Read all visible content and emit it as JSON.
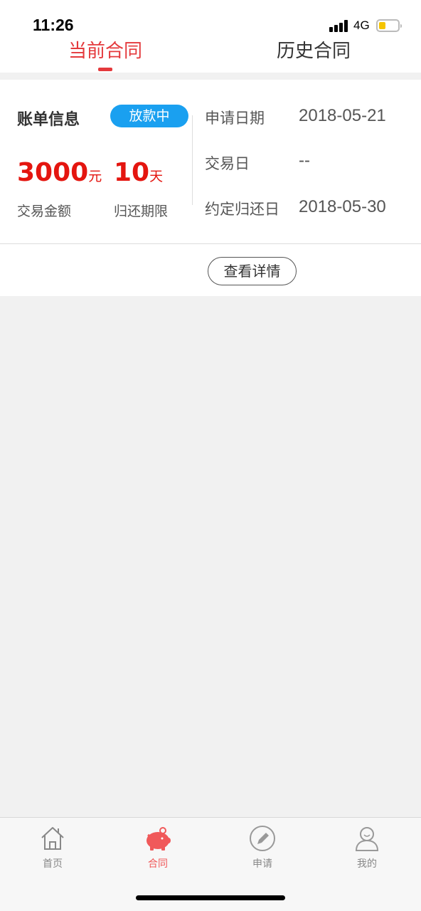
{
  "status_bar": {
    "time": "11:26",
    "network": "4G",
    "battery_level": 0.3,
    "battery_color": "#f5c400"
  },
  "tabs": [
    {
      "label": "当前合同",
      "active": true
    },
    {
      "label": "历史合同",
      "active": false
    }
  ],
  "bill": {
    "title": "账单信息",
    "status": "放款中",
    "amount": "3000",
    "amount_unit": "元",
    "amount_label": "交易金额",
    "term": "10",
    "term_unit": "天",
    "term_label": "归还期限"
  },
  "info": {
    "apply_date_label": "申请日期",
    "apply_date": "2018-05-21",
    "trade_date_label": "交易日",
    "trade_date": "--",
    "due_date_label": "约定归还日",
    "due_date": "2018-05-30"
  },
  "detail_button": "查看详情",
  "bottom_nav": [
    {
      "label": "首页",
      "icon": "home-icon",
      "active": false
    },
    {
      "label": "合同",
      "icon": "piggy-bank-icon",
      "active": true
    },
    {
      "label": "申请",
      "icon": "pen-icon",
      "active": false
    },
    {
      "label": "我的",
      "icon": "user-icon",
      "active": false
    }
  ],
  "colors": {
    "accent_red": "#e4393c",
    "badge_blue": "#1aa0f0",
    "nav_active": "#f0595a"
  }
}
